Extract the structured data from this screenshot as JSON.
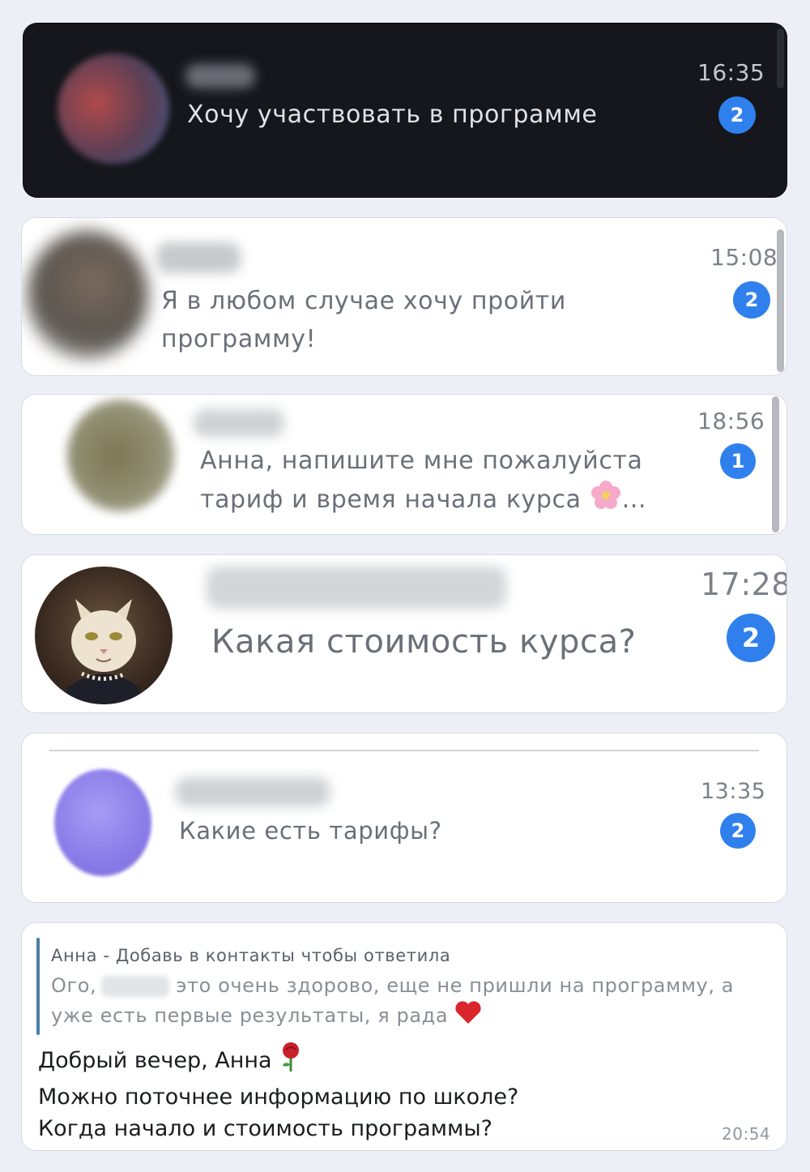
{
  "chats": [
    {
      "message": "Хочу участвовать в программе",
      "time": "16:35",
      "unread": "2"
    },
    {
      "message_line1": "Я в любом случае хочу пройти",
      "message_line2": "программу!",
      "time": "15:08",
      "unread": "2"
    },
    {
      "message_line1": "Анна, напишите мне пожалуйста",
      "message_line2": "тариф и время начала курса",
      "ellipsis": "...",
      "time": "18:56",
      "unread": "1"
    },
    {
      "message": "Какая стоимость курса?",
      "time": "17:28",
      "unread": "2"
    },
    {
      "message": "Какие есть тарифы?",
      "time": "13:35",
      "unread": "2"
    }
  ],
  "bubble": {
    "reply_author": "Анна - Добавь в контакты чтобы ответила",
    "reply_line1_start": "Ого,",
    "reply_line1_end": "это очень здорово, еще не пришли на программу, а",
    "reply_line2": "уже есть первые результаты, я рада",
    "line1": "Добрый вечер, Анна",
    "line2": "Можно поточнее информацию по школе?",
    "line3": "Когда начало и стоимость программы?",
    "time": "20:54"
  },
  "icons": [
    "flower-emoji-icon",
    "heart-emoji-icon",
    "rose-emoji-icon"
  ],
  "colors": {
    "badge": "#2f80ed",
    "dark_card": "#15171c",
    "page_bg": "#ecf0f6",
    "reply_bar": "#4a7fa8"
  }
}
